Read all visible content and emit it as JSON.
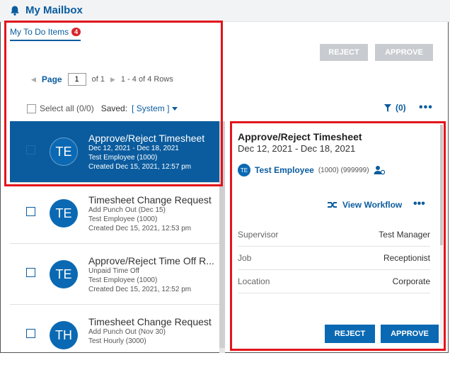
{
  "header": {
    "title": "My Mailbox",
    "icon": "bell-icon"
  },
  "tabs": [
    {
      "label": "My To Do Items",
      "badge": "4"
    }
  ],
  "toolbar": {
    "reject_label": "REJECT",
    "approve_label": "APPROVE"
  },
  "pager": {
    "page_label": "Page",
    "page_value": "1",
    "of_text": "of 1",
    "rows_text": "1 - 4 of 4 Rows"
  },
  "selection": {
    "select_all": "Select all (0/0)",
    "saved_label": "Saved:",
    "saved_value": "[ System ]"
  },
  "filter": {
    "count": "(0)"
  },
  "items": [
    {
      "initials": "TE",
      "title": "Approve/Reject Timesheet",
      "line1": "Dec 12, 2021 - Dec 18, 2021",
      "line2": "Test Employee (1000)",
      "line3": "Created Dec 15, 2021, 12:57 pm"
    },
    {
      "initials": "TE",
      "title": "Timesheet Change Request",
      "line1": "Add Punch Out (Dec 15)",
      "line2": "Test Employee (1000)",
      "line3": "Created Dec 15, 2021, 12:53 pm"
    },
    {
      "initials": "TE",
      "title": "Approve/Reject Time Off R...",
      "line1": "Unpaid Time Off",
      "line2": "Test Employee (1000)",
      "line3": "Created Dec 15, 2021, 12:52 pm"
    },
    {
      "initials": "TH",
      "title": "Timesheet Change Request",
      "line1": "Add Punch Out (Nov 30)",
      "line2": "Test Hourly (3000)",
      "line3": ""
    }
  ],
  "detail": {
    "title": "Approve/Reject Timesheet",
    "dates": "Dec 12, 2021 - Dec 18, 2021",
    "avatar": "TE",
    "employee": "Test Employee",
    "ids": "(1000) (999999)",
    "view_workflow": "View Workflow",
    "fields": [
      {
        "label": "Supervisor",
        "value": "Test Manager"
      },
      {
        "label": "Job",
        "value": "Receptionist"
      },
      {
        "label": "Location",
        "value": "Corporate"
      }
    ],
    "reject_label": "REJECT",
    "approve_label": "APPROVE"
  },
  "colors": {
    "primary": "#0b5c9e",
    "highlight": "#e3141b",
    "badge": "#d9262b"
  }
}
